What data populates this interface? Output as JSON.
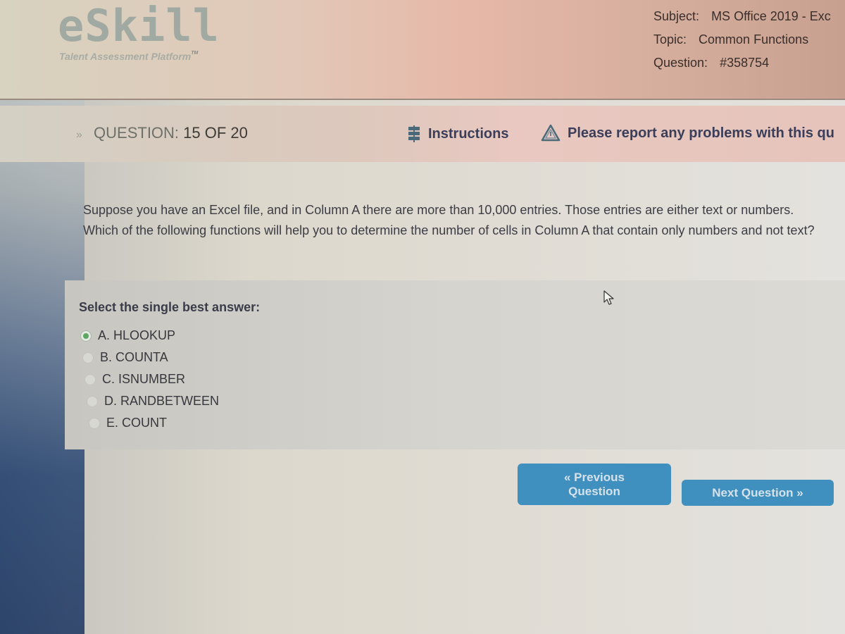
{
  "header": {
    "logo_text": "eSkill",
    "logo_tagline": "Talent Assessment Platform",
    "logo_tm": "TM",
    "meta": [
      {
        "label": "Subject:",
        "value": "MS Office 2019 - Exc"
      },
      {
        "label": "Topic:",
        "value": "Common Functions"
      },
      {
        "label": "Question:",
        "value": "#358754"
      }
    ]
  },
  "question_bar": {
    "chevron": "»",
    "label": "QUESTION:",
    "progress": "15 OF 20",
    "current": 15,
    "total": 20,
    "instructions_label": "Instructions",
    "instructions_icon": "signpost-icon",
    "report_label": "Please report any problems with this qu",
    "report_icon": "warning-triangle-icon"
  },
  "question": {
    "text": "Suppose you have an Excel file, and in Column A there are more than 10,000 entries. Those entries are either text or numbers. Which of the following functions will help you to determine the number of cells in Column A that contain only numbers and not text?"
  },
  "answers": {
    "prompt": "Select the single best answer:",
    "selected": "A",
    "options": [
      {
        "key": "A",
        "label": "A. HLOOKUP"
      },
      {
        "key": "B",
        "label": "B. COUNTA"
      },
      {
        "key": "C",
        "label": "C. ISNUMBER"
      },
      {
        "key": "D",
        "label": "D. RANDBETWEEN"
      },
      {
        "key": "E",
        "label": "E. COUNT"
      }
    ]
  },
  "navigation": {
    "prev_line1": "« Previous",
    "prev_line2": "Question",
    "next_label": "Next Question »",
    "accent_color": "#3f8fbf"
  }
}
